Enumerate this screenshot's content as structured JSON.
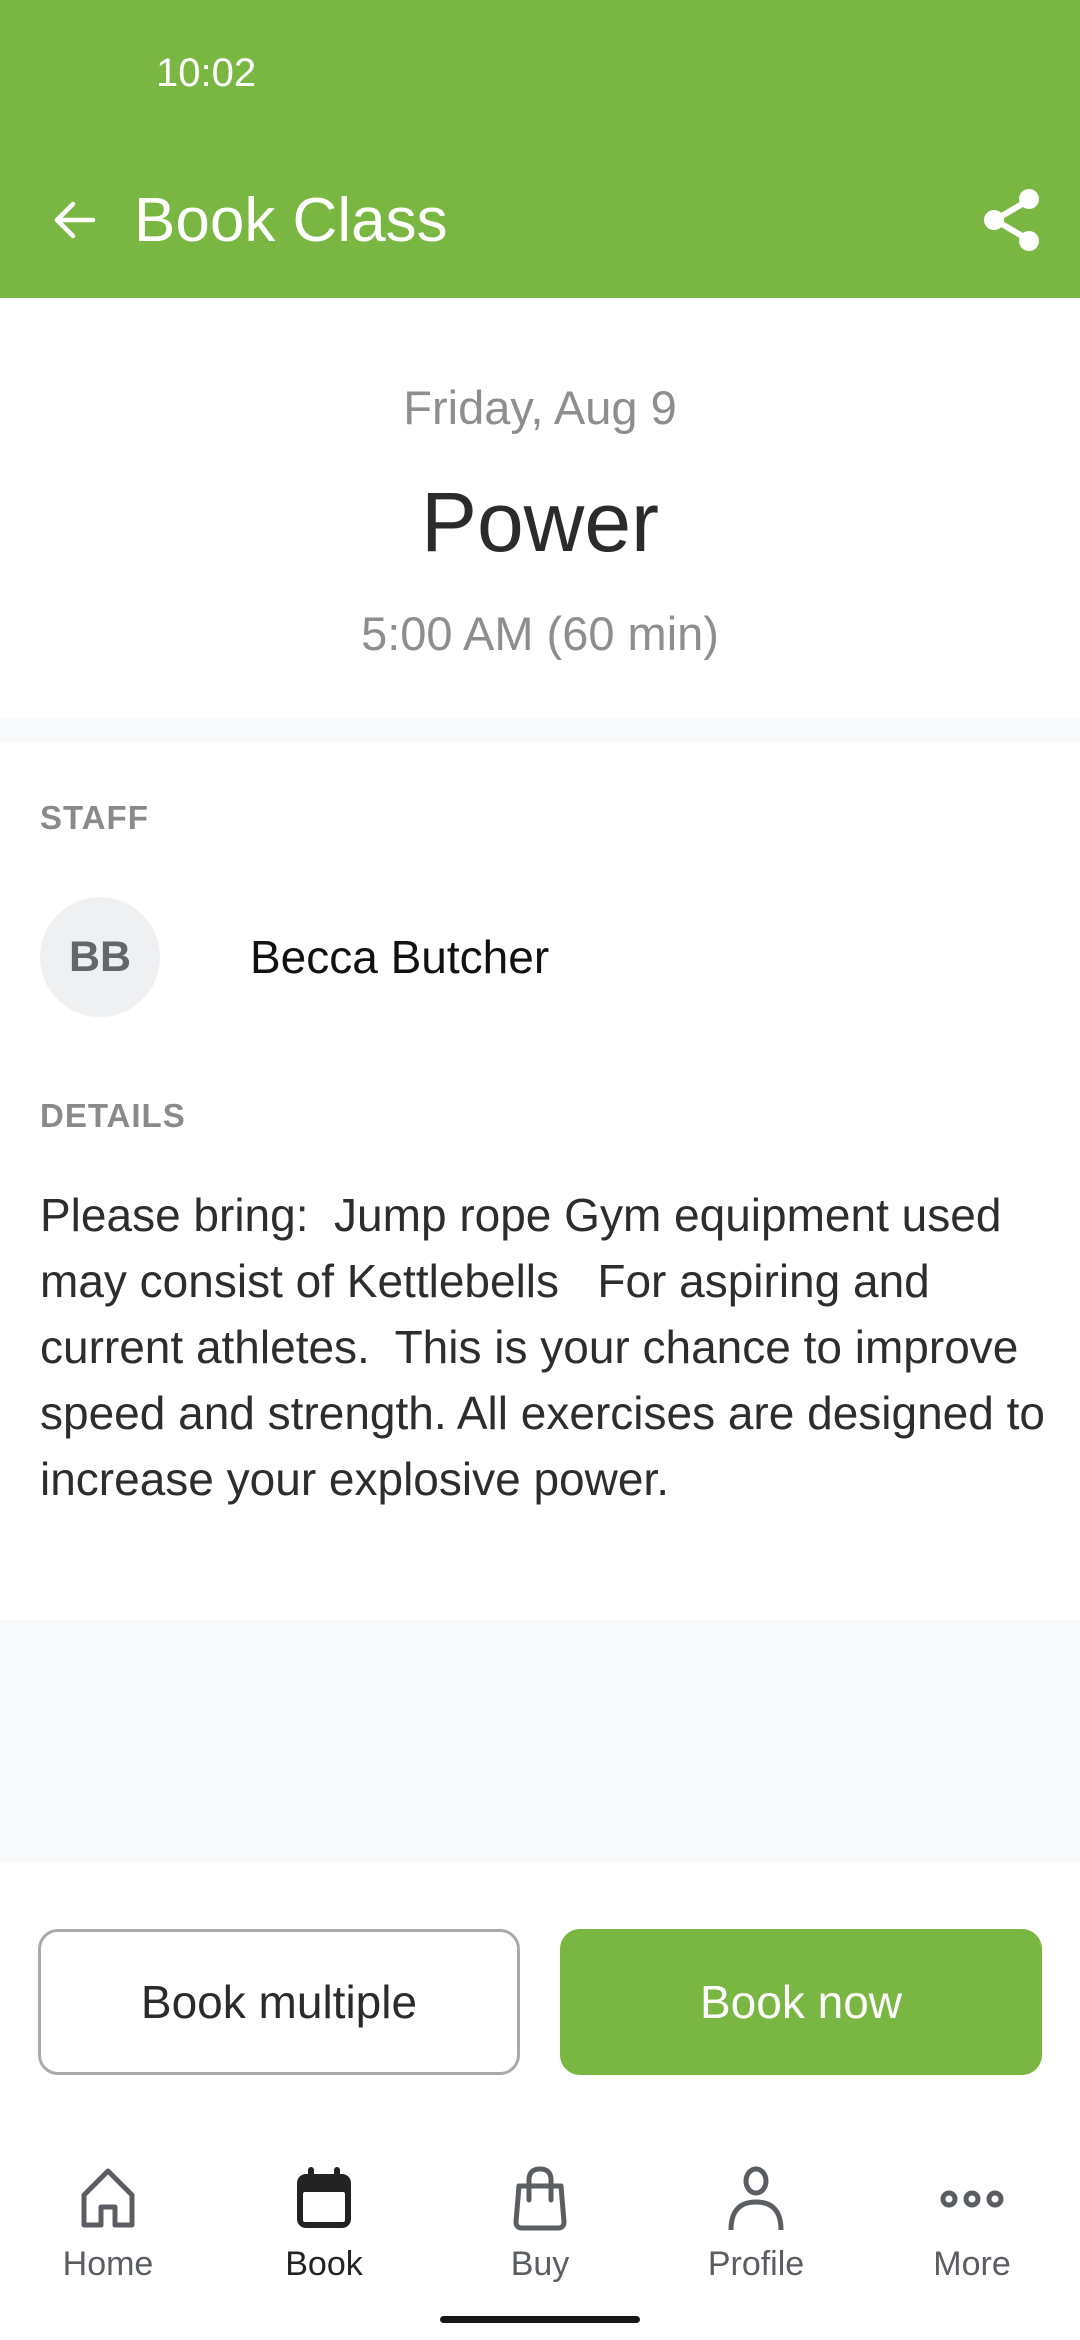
{
  "status_bar": {
    "time": "10:02"
  },
  "app_bar": {
    "title": "Book Class",
    "back_icon": "arrow-back-icon",
    "share_icon": "share-icon",
    "color": "#7ab742"
  },
  "class": {
    "date": "Friday, Aug 9",
    "name": "Power",
    "time": "5:00 AM (60 min)"
  },
  "staff": {
    "label": "STAFF",
    "initials": "BB",
    "name": "Becca Butcher"
  },
  "details": {
    "label": "DETAILS",
    "text": "Please bring:  Jump rope Gym equipment used may consist of Kettlebells   For aspiring and current athletes.  This is your chance to improve speed and strength. All exercises are designed to increase your explosive power."
  },
  "actions": {
    "book_multiple": "Book multiple",
    "book_now": "Book now"
  },
  "bottom_nav": {
    "items": [
      {
        "label": "Home",
        "icon": "home-icon",
        "active": false
      },
      {
        "label": "Book",
        "icon": "calendar-icon",
        "active": true
      },
      {
        "label": "Buy",
        "icon": "shopping-bag-icon",
        "active": false
      },
      {
        "label": "Profile",
        "icon": "person-icon",
        "active": false
      },
      {
        "label": "More",
        "icon": "more-horizontal-icon",
        "active": false
      }
    ]
  }
}
